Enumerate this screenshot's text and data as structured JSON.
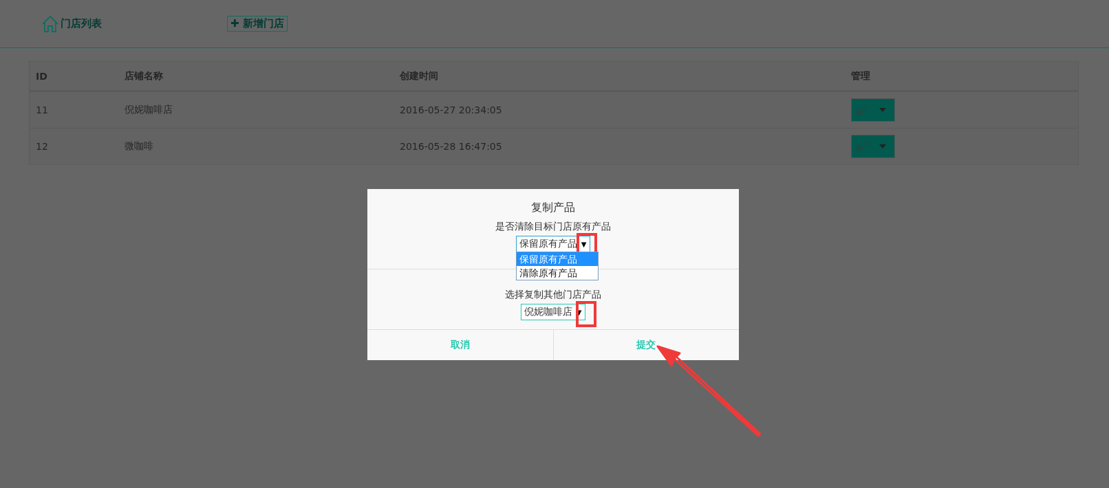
{
  "nav": {
    "home_link": "门店列表",
    "add_button": "✚ 新增门店"
  },
  "table": {
    "columns": [
      "ID",
      "店铺名称",
      "创建时间",
      "管理"
    ],
    "rows": [
      {
        "id": "11",
        "name": "倪妮咖啡店",
        "created": "2016-05-27 20:34:05"
      },
      {
        "id": "12",
        "name": "微咖啡",
        "created": "2016-05-28 16:47:05"
      }
    ]
  },
  "dialog": {
    "title": "复制产品",
    "clear_label": "是否清除目标门店原有产品",
    "clear_select": {
      "value": "保留原有产品",
      "arrow": "▼",
      "expanded": true,
      "options": [
        {
          "label": "保留原有产品",
          "selected": true
        },
        {
          "label": "清除原有产品",
          "selected": false
        }
      ]
    },
    "source_label": "选择复制其他门店产品",
    "source_select": {
      "value": "倪妮咖啡店",
      "arrow": "▼"
    },
    "buttons": [
      "取消",
      "提交"
    ]
  }
}
